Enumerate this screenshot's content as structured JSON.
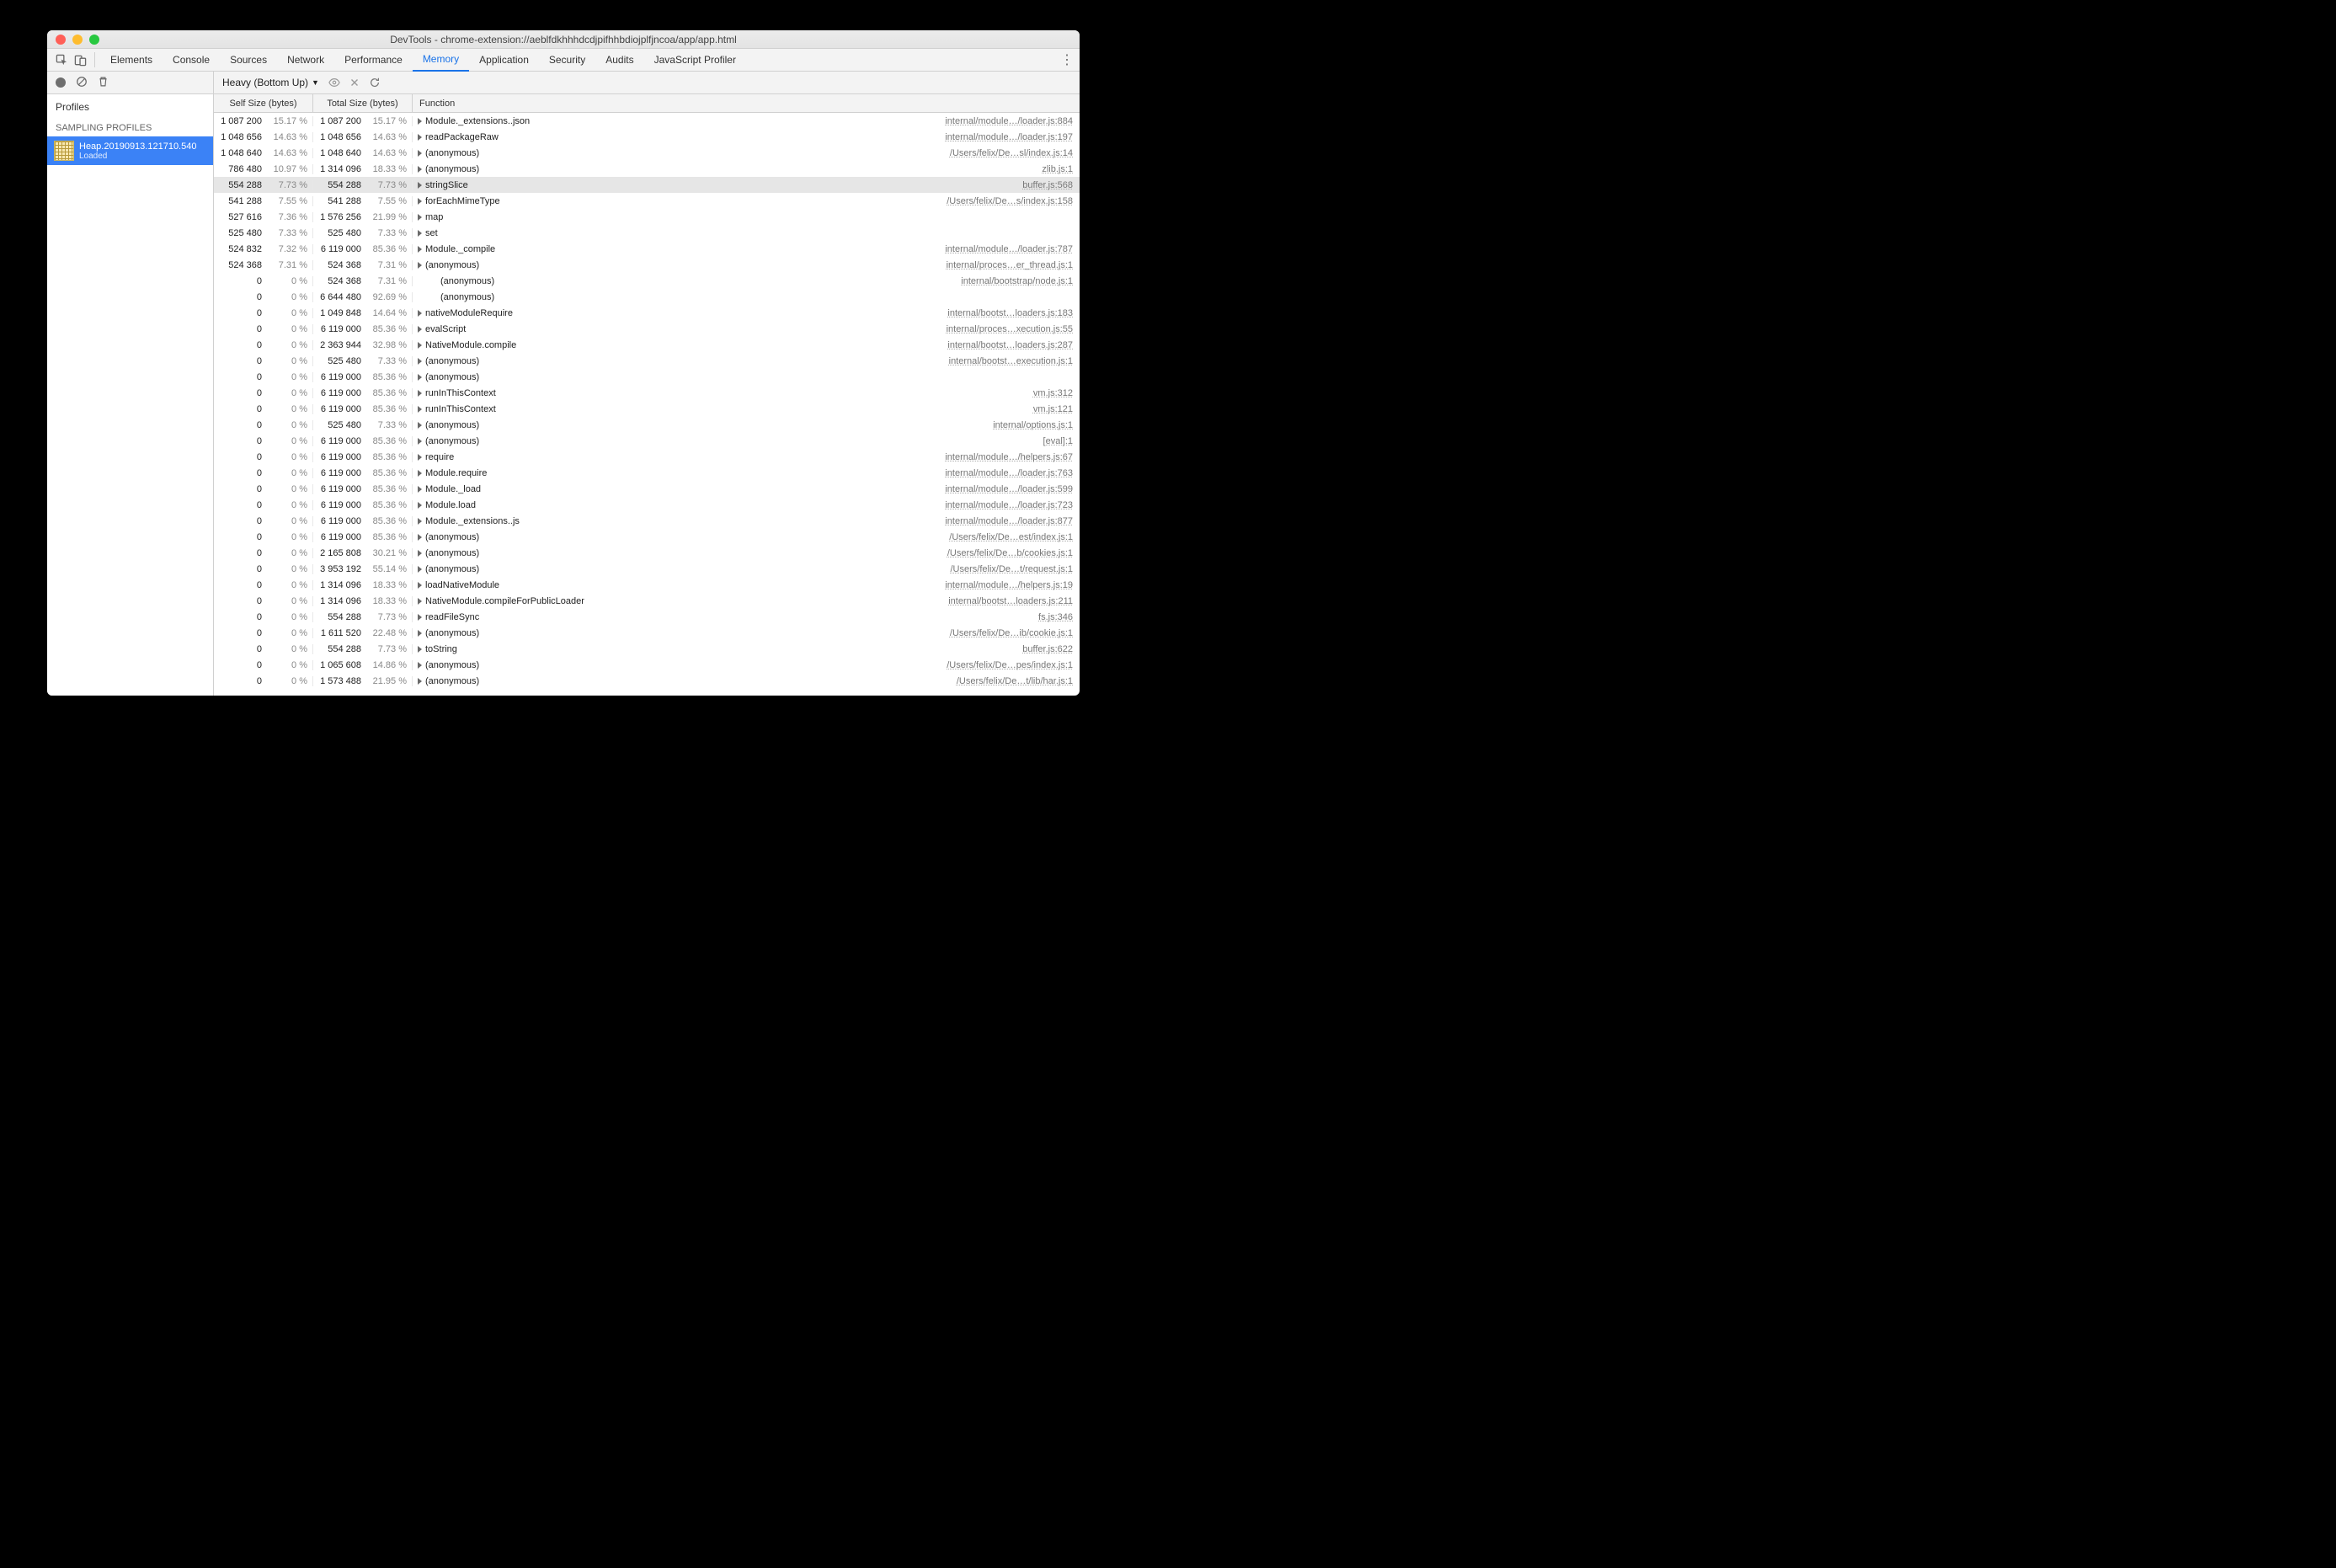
{
  "window": {
    "title": "DevTools - chrome-extension://aeblfdkhhhdcdjpifhhbdiojplfjncoa/app/app.html"
  },
  "tabs": {
    "items": [
      "Elements",
      "Console",
      "Sources",
      "Network",
      "Performance",
      "Memory",
      "Application",
      "Security",
      "Audits",
      "JavaScript Profiler"
    ],
    "active_index": 5
  },
  "toolbar": {
    "dropdown_label": "Heavy (Bottom Up)"
  },
  "sidebar": {
    "profiles_label": "Profiles",
    "section_label": "SAMPLING PROFILES",
    "item": {
      "name": "Heap.20190913.121710.540",
      "status": "Loaded"
    }
  },
  "columns": {
    "self": "Self Size (bytes)",
    "total": "Total Size (bytes)",
    "func": "Function"
  },
  "rows": [
    {
      "self": "1 087 200",
      "self_pct": "15.17 %",
      "total": "1 087 200",
      "total_pct": "15.17 %",
      "tri": true,
      "indent": 0,
      "fn": "Module._extensions..json",
      "loc": "internal/module…/loader.js:884"
    },
    {
      "self": "1 048 656",
      "self_pct": "14.63 %",
      "total": "1 048 656",
      "total_pct": "14.63 %",
      "tri": true,
      "indent": 0,
      "fn": "readPackageRaw",
      "loc": "internal/module…/loader.js:197"
    },
    {
      "self": "1 048 640",
      "self_pct": "14.63 %",
      "total": "1 048 640",
      "total_pct": "14.63 %",
      "tri": true,
      "indent": 0,
      "fn": "(anonymous)",
      "loc": "/Users/felix/De…sl/index.js:14"
    },
    {
      "self": "786 480",
      "self_pct": "10.97 %",
      "total": "1 314 096",
      "total_pct": "18.33 %",
      "tri": true,
      "indent": 0,
      "fn": "(anonymous)",
      "loc": "zlib.js:1"
    },
    {
      "self": "554 288",
      "self_pct": "7.73 %",
      "total": "554 288",
      "total_pct": "7.73 %",
      "tri": true,
      "indent": 0,
      "fn": "stringSlice",
      "loc": "buffer.js:568",
      "selected": true
    },
    {
      "self": "541 288",
      "self_pct": "7.55 %",
      "total": "541 288",
      "total_pct": "7.55 %",
      "tri": true,
      "indent": 0,
      "fn": "forEachMimeType",
      "loc": "/Users/felix/De…s/index.js:158"
    },
    {
      "self": "527 616",
      "self_pct": "7.36 %",
      "total": "1 576 256",
      "total_pct": "21.99 %",
      "tri": true,
      "indent": 0,
      "fn": "map",
      "loc": ""
    },
    {
      "self": "525 480",
      "self_pct": "7.33 %",
      "total": "525 480",
      "total_pct": "7.33 %",
      "tri": true,
      "indent": 0,
      "fn": "set",
      "loc": ""
    },
    {
      "self": "524 832",
      "self_pct": "7.32 %",
      "total": "6 119 000",
      "total_pct": "85.36 %",
      "tri": true,
      "indent": 0,
      "fn": "Module._compile",
      "loc": "internal/module…/loader.js:787"
    },
    {
      "self": "524 368",
      "self_pct": "7.31 %",
      "total": "524 368",
      "total_pct": "7.31 %",
      "tri": true,
      "indent": 0,
      "fn": "(anonymous)",
      "loc": "internal/proces…er_thread.js:1"
    },
    {
      "self": "0",
      "self_pct": "0 %",
      "total": "524 368",
      "total_pct": "7.31 %",
      "tri": false,
      "indent": 1,
      "fn": "(anonymous)",
      "loc": "internal/bootstrap/node.js:1"
    },
    {
      "self": "0",
      "self_pct": "0 %",
      "total": "6 644 480",
      "total_pct": "92.69 %",
      "tri": false,
      "indent": 1,
      "fn": "(anonymous)",
      "loc": ""
    },
    {
      "self": "0",
      "self_pct": "0 %",
      "total": "1 049 848",
      "total_pct": "14.64 %",
      "tri": true,
      "indent": 0,
      "fn": "nativeModuleRequire",
      "loc": "internal/bootst…loaders.js:183"
    },
    {
      "self": "0",
      "self_pct": "0 %",
      "total": "6 119 000",
      "total_pct": "85.36 %",
      "tri": true,
      "indent": 0,
      "fn": "evalScript",
      "loc": "internal/proces…xecution.js:55"
    },
    {
      "self": "0",
      "self_pct": "0 %",
      "total": "2 363 944",
      "total_pct": "32.98 %",
      "tri": true,
      "indent": 0,
      "fn": "NativeModule.compile",
      "loc": "internal/bootst…loaders.js:287"
    },
    {
      "self": "0",
      "self_pct": "0 %",
      "total": "525 480",
      "total_pct": "7.33 %",
      "tri": true,
      "indent": 0,
      "fn": "(anonymous)",
      "loc": "internal/bootst…execution.js:1"
    },
    {
      "self": "0",
      "self_pct": "0 %",
      "total": "6 119 000",
      "total_pct": "85.36 %",
      "tri": true,
      "indent": 0,
      "fn": "(anonymous)",
      "loc": ""
    },
    {
      "self": "0",
      "self_pct": "0 %",
      "total": "6 119 000",
      "total_pct": "85.36 %",
      "tri": true,
      "indent": 0,
      "fn": "runInThisContext",
      "loc": "vm.js:312"
    },
    {
      "self": "0",
      "self_pct": "0 %",
      "total": "6 119 000",
      "total_pct": "85.36 %",
      "tri": true,
      "indent": 0,
      "fn": "runInThisContext",
      "loc": "vm.js:121"
    },
    {
      "self": "0",
      "self_pct": "0 %",
      "total": "525 480",
      "total_pct": "7.33 %",
      "tri": true,
      "indent": 0,
      "fn": "(anonymous)",
      "loc": "internal/options.js:1"
    },
    {
      "self": "0",
      "self_pct": "0 %",
      "total": "6 119 000",
      "total_pct": "85.36 %",
      "tri": true,
      "indent": 0,
      "fn": "(anonymous)",
      "loc": "[eval]:1"
    },
    {
      "self": "0",
      "self_pct": "0 %",
      "total": "6 119 000",
      "total_pct": "85.36 %",
      "tri": true,
      "indent": 0,
      "fn": "require",
      "loc": "internal/module…/helpers.js:67"
    },
    {
      "self": "0",
      "self_pct": "0 %",
      "total": "6 119 000",
      "total_pct": "85.36 %",
      "tri": true,
      "indent": 0,
      "fn": "Module.require",
      "loc": "internal/module…/loader.js:763"
    },
    {
      "self": "0",
      "self_pct": "0 %",
      "total": "6 119 000",
      "total_pct": "85.36 %",
      "tri": true,
      "indent": 0,
      "fn": "Module._load",
      "loc": "internal/module…/loader.js:599"
    },
    {
      "self": "0",
      "self_pct": "0 %",
      "total": "6 119 000",
      "total_pct": "85.36 %",
      "tri": true,
      "indent": 0,
      "fn": "Module.load",
      "loc": "internal/module…/loader.js:723"
    },
    {
      "self": "0",
      "self_pct": "0 %",
      "total": "6 119 000",
      "total_pct": "85.36 %",
      "tri": true,
      "indent": 0,
      "fn": "Module._extensions..js",
      "loc": "internal/module…/loader.js:877"
    },
    {
      "self": "0",
      "self_pct": "0 %",
      "total": "6 119 000",
      "total_pct": "85.36 %",
      "tri": true,
      "indent": 0,
      "fn": "(anonymous)",
      "loc": "/Users/felix/De…est/index.js:1"
    },
    {
      "self": "0",
      "self_pct": "0 %",
      "total": "2 165 808",
      "total_pct": "30.21 %",
      "tri": true,
      "indent": 0,
      "fn": "(anonymous)",
      "loc": "/Users/felix/De…b/cookies.js:1"
    },
    {
      "self": "0",
      "self_pct": "0 %",
      "total": "3 953 192",
      "total_pct": "55.14 %",
      "tri": true,
      "indent": 0,
      "fn": "(anonymous)",
      "loc": "/Users/felix/De…t/request.js:1"
    },
    {
      "self": "0",
      "self_pct": "0 %",
      "total": "1 314 096",
      "total_pct": "18.33 %",
      "tri": true,
      "indent": 0,
      "fn": "loadNativeModule",
      "loc": "internal/module…/helpers.js:19"
    },
    {
      "self": "0",
      "self_pct": "0 %",
      "total": "1 314 096",
      "total_pct": "18.33 %",
      "tri": true,
      "indent": 0,
      "fn": "NativeModule.compileForPublicLoader",
      "loc": "internal/bootst…loaders.js:211"
    },
    {
      "self": "0",
      "self_pct": "0 %",
      "total": "554 288",
      "total_pct": "7.73 %",
      "tri": true,
      "indent": 0,
      "fn": "readFileSync",
      "loc": "fs.js:346"
    },
    {
      "self": "0",
      "self_pct": "0 %",
      "total": "1 611 520",
      "total_pct": "22.48 %",
      "tri": true,
      "indent": 0,
      "fn": "(anonymous)",
      "loc": "/Users/felix/De…ib/cookie.js:1"
    },
    {
      "self": "0",
      "self_pct": "0 %",
      "total": "554 288",
      "total_pct": "7.73 %",
      "tri": true,
      "indent": 0,
      "fn": "toString",
      "loc": "buffer.js:622"
    },
    {
      "self": "0",
      "self_pct": "0 %",
      "total": "1 065 608",
      "total_pct": "14.86 %",
      "tri": true,
      "indent": 0,
      "fn": "(anonymous)",
      "loc": "/Users/felix/De…pes/index.js:1"
    },
    {
      "self": "0",
      "self_pct": "0 %",
      "total": "1 573 488",
      "total_pct": "21.95 %",
      "tri": true,
      "indent": 0,
      "fn": "(anonymous)",
      "loc": "/Users/felix/De…t/lib/har.js:1"
    }
  ]
}
